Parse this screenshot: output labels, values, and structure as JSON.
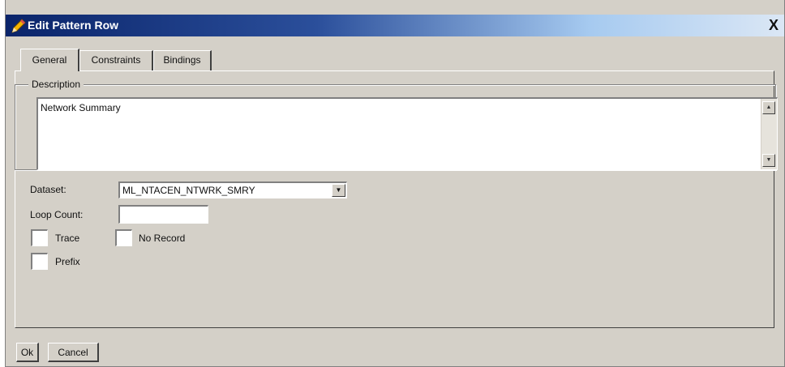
{
  "window": {
    "title": "Edit Pattern Row",
    "close_label": "X"
  },
  "tabs": [
    {
      "label": "General",
      "active": true
    },
    {
      "label": "Constraints",
      "active": false
    },
    {
      "label": "Bindings",
      "active": false
    }
  ],
  "description": {
    "legend": "Description",
    "value": "Network Summary"
  },
  "form": {
    "dataset_label": "Dataset:",
    "dataset_value": "ML_NTACEN_NTWRK_SMRY",
    "loop_count_label": "Loop Count:",
    "loop_count_value": "",
    "trace_label": "Trace",
    "no_record_label": "No Record",
    "prefix_label": "Prefix"
  },
  "buttons": {
    "ok": "Ok",
    "cancel": "Cancel"
  },
  "icons": {
    "title": "pencil-icon",
    "scroll_up": "up-arrow-icon",
    "scroll_down": "down-arrow-icon",
    "dropdown": "down-arrow-icon"
  },
  "colors": {
    "titlebar_start": "#0a246a",
    "titlebar_end": "#dbe7f5",
    "dialog_bg": "#d4d0c8"
  }
}
